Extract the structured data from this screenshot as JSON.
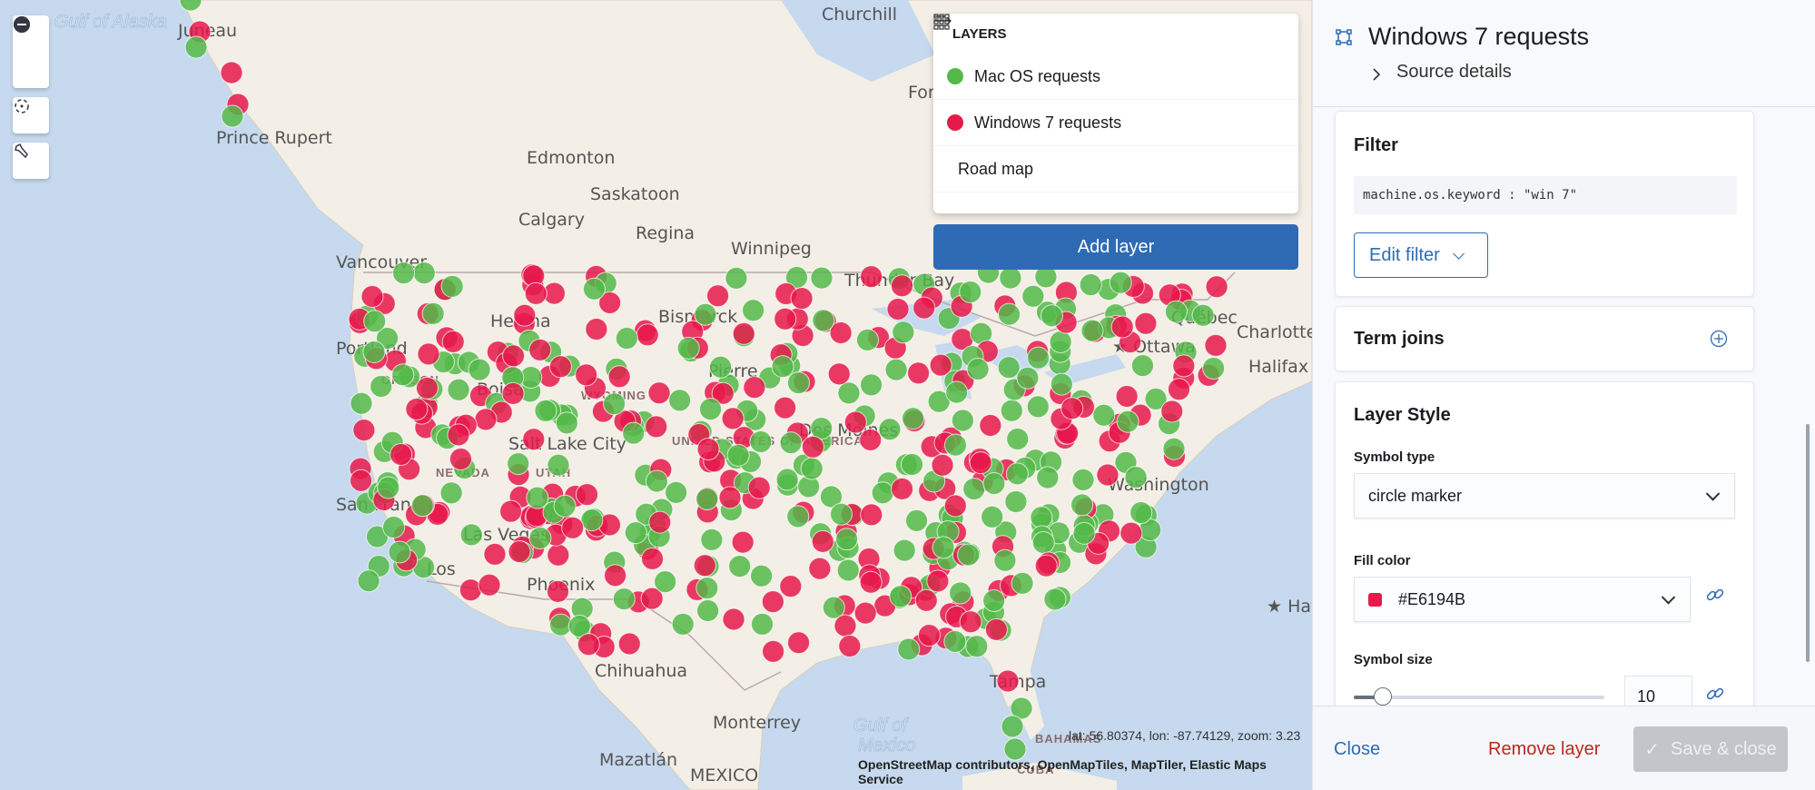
{
  "map": {
    "labels": [
      {
        "text": "Churchill",
        "cls": "lbl"
      },
      {
        "text": "Fort Se",
        "cls": "lbl"
      },
      {
        "text": "Edmonton",
        "cls": "lbl"
      },
      {
        "text": "Saskatoon",
        "cls": "lbl"
      },
      {
        "text": "Calgary",
        "cls": "lbl"
      },
      {
        "text": "Regina",
        "cls": "lbl"
      },
      {
        "text": "Winnipeg",
        "cls": "lbl"
      },
      {
        "text": "Thunder Bay",
        "cls": "lbl"
      },
      {
        "text": "Vancouver",
        "cls": "lbl"
      },
      {
        "text": "Québec",
        "cls": "lbl"
      },
      {
        "text": "★ Ottawa",
        "cls": "lbl"
      },
      {
        "text": "Charlotte",
        "cls": "lbl"
      },
      {
        "text": "Halifax",
        "cls": "lbl"
      },
      {
        "text": "Prince Rupert",
        "cls": "lbl"
      },
      {
        "text": "Juneau",
        "cls": "lbl"
      },
      {
        "text": "Salt Lake City",
        "cls": "lbl"
      },
      {
        "text": "San Fran",
        "cls": "lbl"
      },
      {
        "text": "Las Vegas",
        "cls": "lbl"
      },
      {
        "text": "Los",
        "cls": "lbl"
      },
      {
        "text": "Phoenix",
        "cls": "lbl"
      },
      {
        "text": "Chihuahua",
        "cls": "lbl"
      },
      {
        "text": "Monterrey",
        "cls": "lbl"
      },
      {
        "text": "Mazatlán",
        "cls": "lbl"
      },
      {
        "text": "MEXICO",
        "cls": "lbl"
      },
      {
        "text": "Tampa",
        "cls": "lbl"
      },
      {
        "text": "★ Hav",
        "cls": "lbl"
      },
      {
        "text": "Helena",
        "cls": "lbl"
      },
      {
        "text": "Bismarck",
        "cls": "lbl"
      },
      {
        "text": "Pierre",
        "cls": "lbl"
      },
      {
        "text": "Boise",
        "cls": "lbl"
      },
      {
        "text": "Des Moines",
        "cls": "lbl"
      },
      {
        "text": "Washington",
        "cls": "lbl"
      },
      {
        "text": "Portland",
        "cls": "lbl"
      },
      {
        "text": "WYOMING",
        "cls": "state"
      },
      {
        "text": "UTAH",
        "cls": "state"
      },
      {
        "text": "NEVADA",
        "cls": "state"
      },
      {
        "text": "OREGON",
        "cls": "state"
      },
      {
        "text": "UNITED STATES OF AMERICA",
        "cls": "state"
      },
      {
        "text": "Gulf of",
        "cls": "water"
      },
      {
        "text": "Mexico",
        "cls": "water"
      },
      {
        "text": "BAHAMAS",
        "cls": "state"
      },
      {
        "text": "CUBA",
        "cls": "state"
      },
      {
        "text": "Gulf of Alaska",
        "cls": "water"
      }
    ],
    "colors": {
      "mac": "#54B949",
      "win": "#E6194B"
    },
    "coords": "lat: 56.80374, lon: -87.74129, zoom: 3.23",
    "attribution": "OpenStreetMap contributors, OpenMapTiles, MapTiler, Elastic Maps Service"
  },
  "layers": {
    "title": "LAYERS",
    "items": [
      {
        "label": "Mac OS requests",
        "icon": "green-circle"
      },
      {
        "label": "Windows 7 requests",
        "icon": "red-circle"
      },
      {
        "label": "Road map",
        "icon": "grid-icon"
      }
    ],
    "add_label": "Add layer"
  },
  "panel": {
    "title": "Windows 7 requests",
    "source_details": "Source details",
    "filter": {
      "title": "Filter",
      "query": "machine.os.keyword : \"win 7\"",
      "edit": "Edit filter"
    },
    "term_joins": {
      "title": "Term joins"
    },
    "style": {
      "title": "Layer Style",
      "symbol_type_label": "Symbol type",
      "symbol_type": "circle marker",
      "fill_label": "Fill color",
      "fill": "#E6194B",
      "size_label": "Symbol size",
      "size": "10"
    },
    "footer": {
      "close": "Close",
      "remove": "Remove layer",
      "save": "Save & close"
    }
  }
}
